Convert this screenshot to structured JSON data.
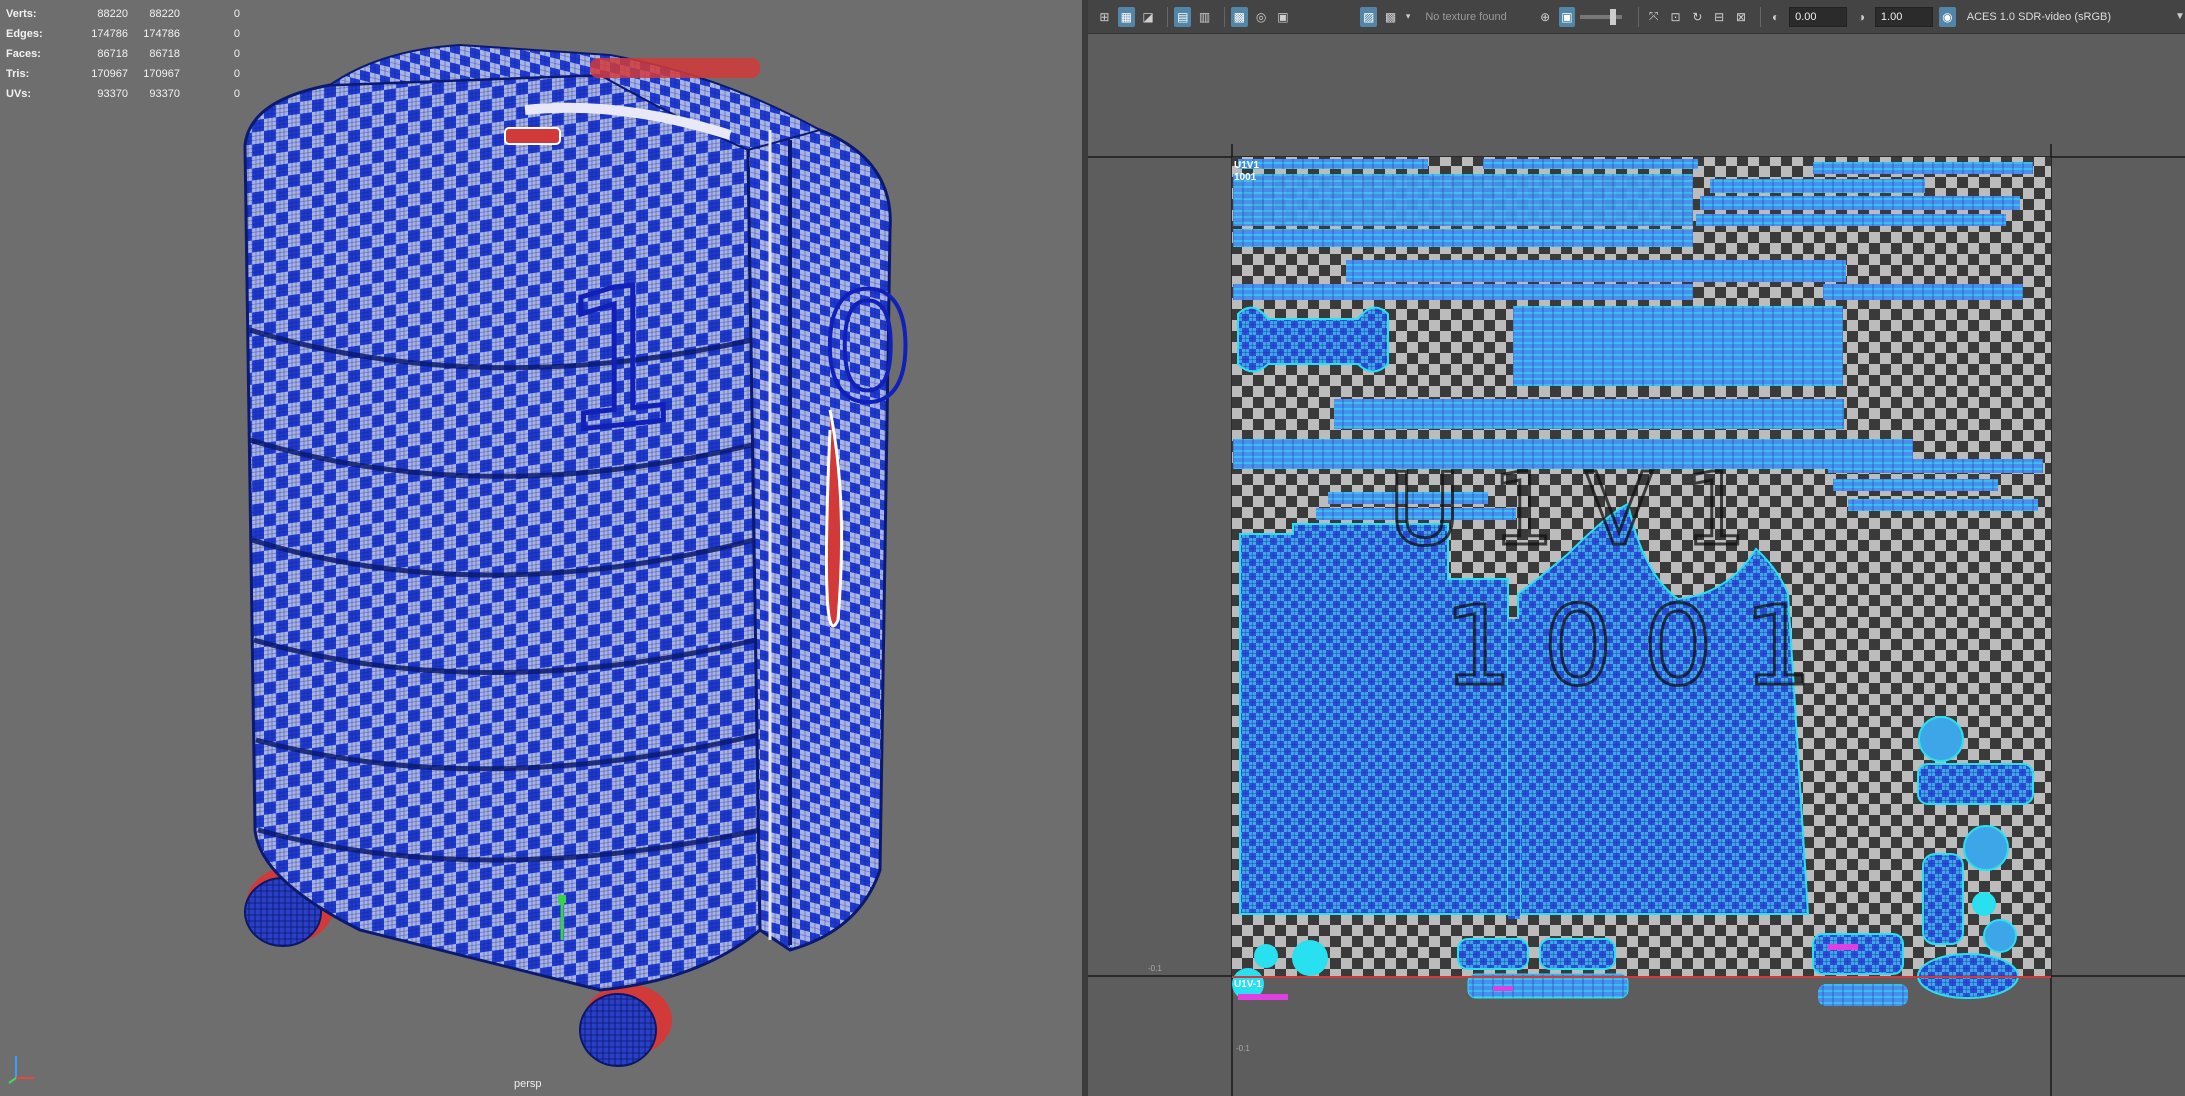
{
  "stats": {
    "rows": [
      {
        "label": "Verts:",
        "a": "88220",
        "b": "88220",
        "c": "0"
      },
      {
        "label": "Edges:",
        "a": "174786",
        "b": "174786",
        "c": "0"
      },
      {
        "label": "Faces:",
        "a": "86718",
        "b": "86718",
        "c": "0"
      },
      {
        "label": "Tris:",
        "a": "170967",
        "b": "170967",
        "c": "0"
      },
      {
        "label": "UVs:",
        "a": "93370",
        "b": "93370",
        "c": "0"
      }
    ]
  },
  "viewport": {
    "camera_label": "persp",
    "checker_color_a": "#1f3ad0",
    "checker_color_b": "#a9b4e6",
    "accent_red": "#d23a3a"
  },
  "uv_toolbar": {
    "no_texture_text": "No texture found",
    "exposure_value": "0.00",
    "gamma_value": "1.00",
    "colorspace": "ACES 1.0 SDR-video (sRGB)",
    "icons": [
      "uv-layout-icon",
      "uv-shell-icon",
      "uv-select-icon",
      "grid-icon",
      "texture-grid-icon",
      "checker-icon",
      "snapshot-icon",
      "image-display-icon",
      "checker-display-icon",
      "dim-image-icon",
      "isolate-icon",
      "shaded-icon",
      "distortion-icon",
      "texture-border-icon",
      "edge-color-icon",
      "exposure-icon",
      "gamma-icon",
      "color-management-icon"
    ]
  },
  "uv_canvas": {
    "tile_name": "U1V1",
    "tile_number": "1001",
    "tile_below": "U1V-1",
    "axis_label_origin": "-0.1",
    "axis_label_bottom": "-0.1",
    "big_watermark_top": "U1V1",
    "big_watermark_bottom": "1001",
    "uv_fill": "#3da6e8",
    "uv_edge": "#28e0f0"
  }
}
